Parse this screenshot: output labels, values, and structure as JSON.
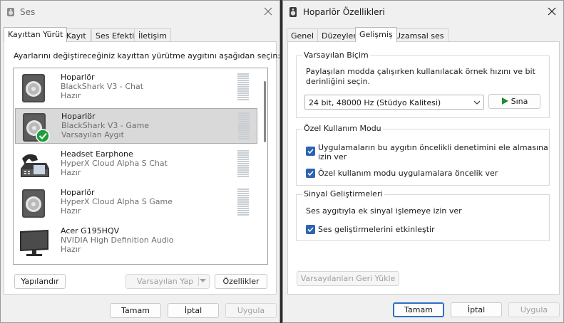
{
  "left_window": {
    "title": "Ses",
    "tabs": [
      "Kayıttan Yürüt",
      "Kayıt",
      "Ses Efekti",
      "İletişim"
    ],
    "instruction": "Ayarlarını değiştireceğiniz kayıttan yürütme aygıtını aşağıdan seçin:",
    "devices": [
      {
        "name": "Hoparlör",
        "desc": "BlackShark V3 - Chat",
        "status": "Hazır",
        "icon": "speaker-icon"
      },
      {
        "name": "Hoparlör",
        "desc": "BlackShark V3 - Game",
        "status": "Varsayılan Aygıt",
        "icon": "speaker-default-icon"
      },
      {
        "name": "Headset Earphone",
        "desc": "HyperX Cloud Alpha S Chat",
        "status": "Hazır",
        "icon": "headset-phone-icon"
      },
      {
        "name": "Hoparlör",
        "desc": "HyperX Cloud Alpha S Game",
        "status": "Hazır",
        "icon": "speaker-icon"
      },
      {
        "name": "Acer G195HQV",
        "desc": "NVIDIA High Definition Audio",
        "status": "Hazır",
        "icon": "monitor-icon"
      }
    ],
    "buttons": {
      "configure": "Yapılandır",
      "set_default": "Varsayılan Yap",
      "properties": "Özellikler",
      "ok": "Tamam",
      "cancel": "İptal",
      "apply": "Uygula"
    }
  },
  "right_window": {
    "title": "Hoparlör Özellikleri",
    "tabs": [
      "Genel",
      "Düzeyler",
      "Gelişmiş",
      "Uzamsal ses"
    ],
    "default_format": {
      "label": "Varsayılan Biçim",
      "desc_line1": "Paylaşılan modda çalışırken kullanılacak örnek hızını ve bit",
      "desc_line2": "derinliğini seçin.",
      "selected": "24 bit, 48000 Hz (Stüdyo Kalitesi)",
      "test_button": "Sına"
    },
    "exclusive": {
      "label": "Özel Kullanım Modu",
      "opt1_line1": "Uygulamaların bu aygıtın öncelikli denetimini ele almasına",
      "opt1_line2": "izin ver",
      "opt2": "Özel kullanım modu uygulamalara öncelik ver"
    },
    "enhancements": {
      "label": "Sinyal Geliştirmeleri",
      "desc": "Ses aygıtıyla ek sinyal işlemeye izin ver",
      "opt": "Ses geliştirmelerini etkinleştir"
    },
    "buttons": {
      "restore": "Varsayılanları Geri Yükle",
      "ok": "Tamam",
      "cancel": "İptal",
      "apply": "Uygula"
    }
  },
  "colors": {
    "accent": "#2b64b4",
    "selected_row": "#d9d9d9",
    "check_badge": "#1f9d3a",
    "play_icon": "#1f8a2e"
  }
}
